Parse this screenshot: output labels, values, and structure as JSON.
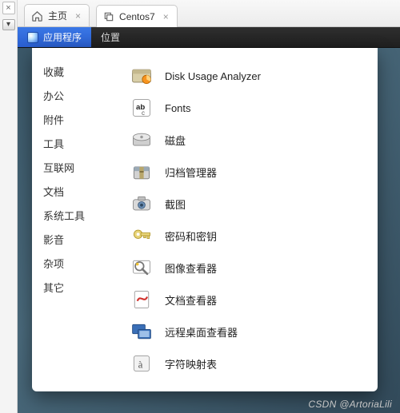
{
  "gutter": {
    "close_glyph": "×",
    "drop_glyph": "▾"
  },
  "tabs": {
    "home": {
      "label": "主页",
      "close": "×"
    },
    "vm": {
      "label": "Centos7",
      "close": "×"
    }
  },
  "gnome_topbar": {
    "applications": "应用程序",
    "places": "位置"
  },
  "menu": {
    "categories": [
      "收藏",
      "办公",
      "附件",
      "工具",
      "互联网",
      "文档",
      "系统工具",
      "影音",
      "杂项",
      "其它"
    ],
    "apps": [
      {
        "label": "Disk Usage Analyzer",
        "icon": "disk-usage-analyzer-icon"
      },
      {
        "label": "Fonts",
        "icon": "fonts-icon"
      },
      {
        "label": "磁盘",
        "icon": "disks-icon"
      },
      {
        "label": "归档管理器",
        "icon": "archive-manager-icon"
      },
      {
        "label": "截图",
        "icon": "screenshot-icon"
      },
      {
        "label": "密码和密钥",
        "icon": "passwords-keys-icon"
      },
      {
        "label": "图像查看器",
        "icon": "image-viewer-icon"
      },
      {
        "label": "文档查看器",
        "icon": "document-viewer-icon"
      },
      {
        "label": "远程桌面查看器",
        "icon": "remote-desktop-viewer-icon"
      },
      {
        "label": "字符映射表",
        "icon": "character-map-icon"
      }
    ]
  },
  "watermark": "CSDN @ArtoriaLili"
}
